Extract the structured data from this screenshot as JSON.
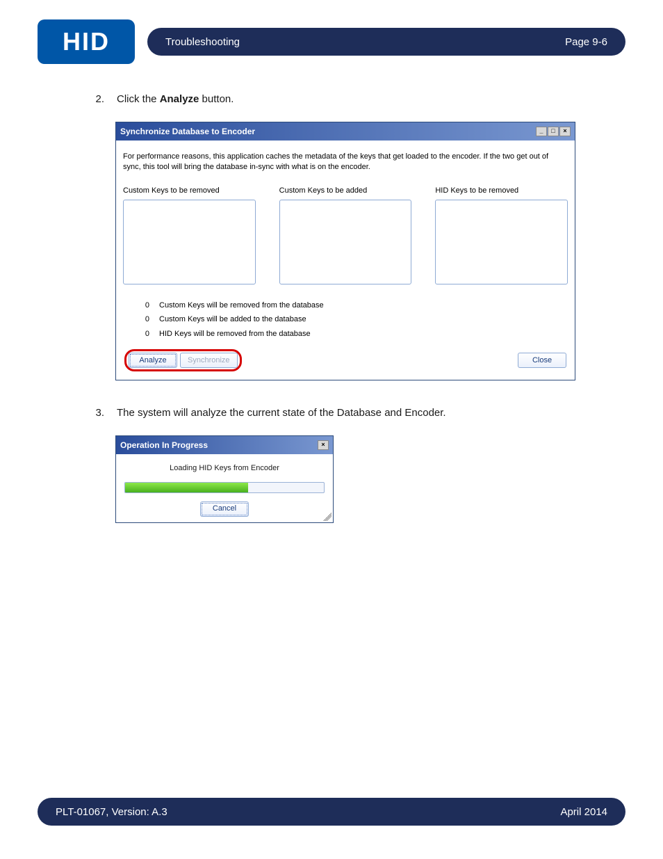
{
  "logo": {
    "text": "HID"
  },
  "header": {
    "left": "Troubleshooting",
    "right": "Page 9-6"
  },
  "steps": [
    {
      "num": "2.",
      "before": "Click the ",
      "bold": "Analyze",
      "after": " button."
    },
    {
      "num": "3.",
      "text": "The system will analyze the current state of the Database and Encoder."
    }
  ],
  "dialog1": {
    "title": "Synchronize Database to Encoder",
    "desc": "For performance reasons, this application caches the metadata of the keys that get loaded to the encoder. If the two get out of sync, this tool will bring the database in-sync with what is on the encoder.",
    "col1": "Custom Keys to be removed",
    "col2": "Custom Keys to be added",
    "col3": "HID Keys to be removed",
    "summary": [
      {
        "n": "0",
        "t": "Custom Keys will be removed from the database"
      },
      {
        "n": "0",
        "t": "Custom Keys will be added to the database"
      },
      {
        "n": "0",
        "t": "HID Keys will be removed from the database"
      }
    ],
    "analyze": "Analyze",
    "synchronize": "Synchronize",
    "close": "Close"
  },
  "dialog2": {
    "title": "Operation In Progress",
    "status": "Loading HID Keys from Encoder",
    "cancel": "Cancel"
  },
  "footer": {
    "left": "PLT-01067, Version: A.3",
    "right": "April 2014"
  }
}
